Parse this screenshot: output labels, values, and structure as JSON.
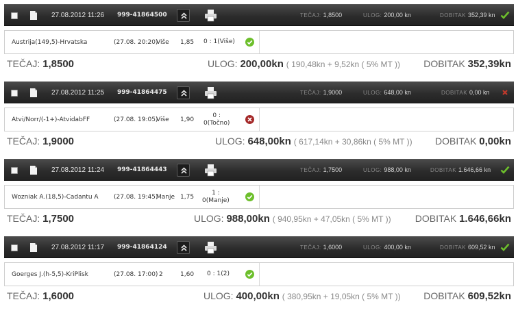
{
  "labels": {
    "tecaj_bar": "TEČAJ:",
    "ulog_bar": "ULOG:",
    "dobitak_bar": "DOBITAK",
    "tecaj": "TEČAJ:",
    "ulog": "ULOG:",
    "dobitak": "DOBITAK"
  },
  "colors": {
    "bar": "#2c2c2c",
    "won": "#6dbf2c",
    "lost": "#c0392b"
  },
  "tickets": [
    {
      "datetime": "27.08.2012 11:26",
      "ticket_id": "999-41864500",
      "status": "won",
      "odds": "1,8500",
      "stake": "200,00 kn",
      "win": "352,39 kn",
      "selection": {
        "match": "Austrija(149,5)-Hrvatska",
        "start": "(27.08. 20:20)",
        "tip": "Više",
        "odds": "1,85",
        "result_l1": "0 : 1(Više)",
        "result_l2": "",
        "status": "won"
      },
      "summary": {
        "odds": "1,8500",
        "stake": "200,00kn",
        "detail": "( 190,48kn + 9,52kn  ( 5% MT ))",
        "win": "352,39kn"
      }
    },
    {
      "datetime": "27.08.2012 11:25",
      "ticket_id": "999-41864475",
      "status": "lost",
      "odds": "1,9000",
      "stake": "648,00 kn",
      "win": "0,00 kn",
      "selection": {
        "match": "Atvi/Norr/(-1+)-AtvidabFF",
        "start": "(27.08. 19:05)",
        "tip": "Više",
        "odds": "1,90",
        "result_l1": "0 :",
        "result_l2": "0(Točno)",
        "status": "lost"
      },
      "summary": {
        "odds": "1,9000",
        "stake": "648,00kn",
        "detail": "( 617,14kn + 30,86kn  ( 5% MT ))",
        "win": "0,00kn"
      }
    },
    {
      "datetime": "27.08.2012 11:24",
      "ticket_id": "999-41864443",
      "status": "won",
      "odds": "1,7500",
      "stake": "988,00 kn",
      "win": "1.646,66 kn",
      "selection": {
        "match": "Wozniak A.(18,5)-Cadantu A",
        "start": "(27.08. 19:45)",
        "tip": "Manje",
        "odds": "1,75",
        "result_l1": "1 :",
        "result_l2": "0(Manje)",
        "status": "won"
      },
      "summary": {
        "odds": "1,7500",
        "stake": "988,00kn",
        "detail": "( 940,95kn + 47,05kn  ( 5% MT ))",
        "win": "1.646,66kn"
      }
    },
    {
      "datetime": "27.08.2012 11:17",
      "ticket_id": "999-41864124",
      "status": "won",
      "odds": "1,6000",
      "stake": "400,00 kn",
      "win": "609,52 kn",
      "selection": {
        "match": "Goerges J.(h-5,5)-KriPlisk",
        "start": "(27.08. 17:00)",
        "tip": "2",
        "odds": "1,60",
        "result_l1": "0 : 1(2)",
        "result_l2": "",
        "status": "won"
      },
      "summary": {
        "odds": "1,6000",
        "stake": "400,00kn",
        "detail": "( 380,95kn + 19,05kn  ( 5% MT ))",
        "win": "609,52kn"
      }
    }
  ]
}
